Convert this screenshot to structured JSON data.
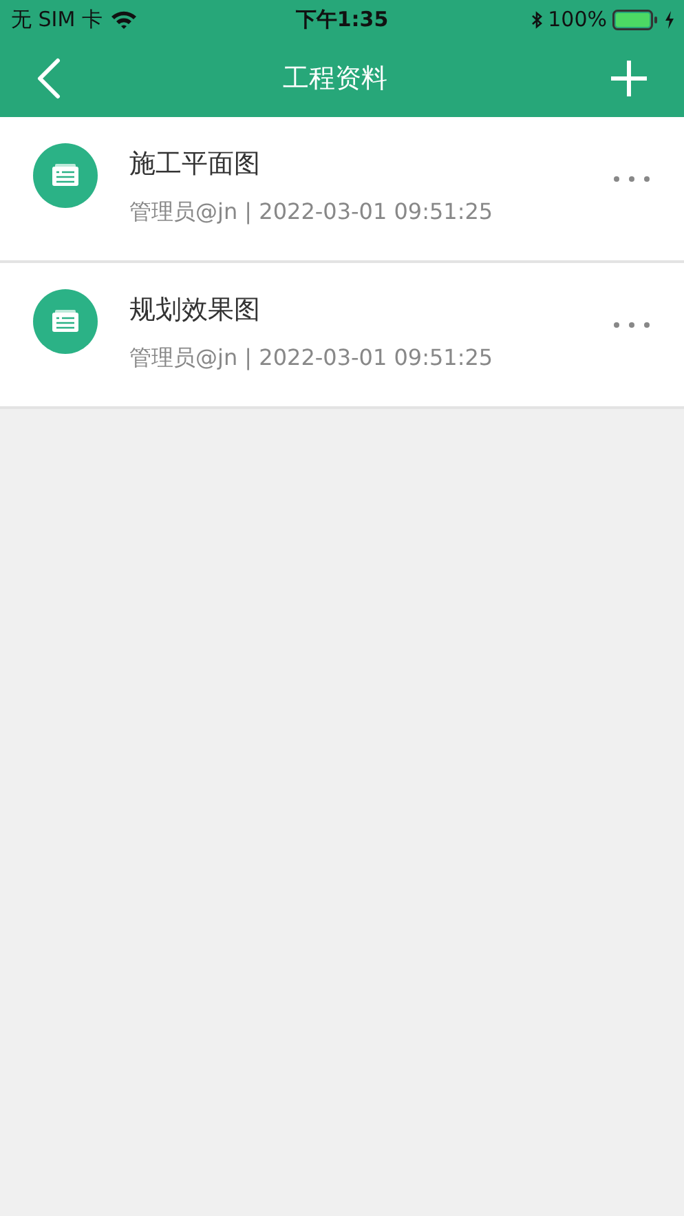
{
  "status_bar": {
    "carrier": "无 SIM 卡",
    "time": "下午1:35",
    "battery": "100%"
  },
  "nav_bar": {
    "title": "工程资料"
  },
  "files": [
    {
      "name": "施工平面图",
      "meta": "管理员@jn | 2022-03-01 09:51:25"
    },
    {
      "name": "规划效果图",
      "meta": "管理员@jn | 2022-03-01 09:51:25"
    }
  ]
}
